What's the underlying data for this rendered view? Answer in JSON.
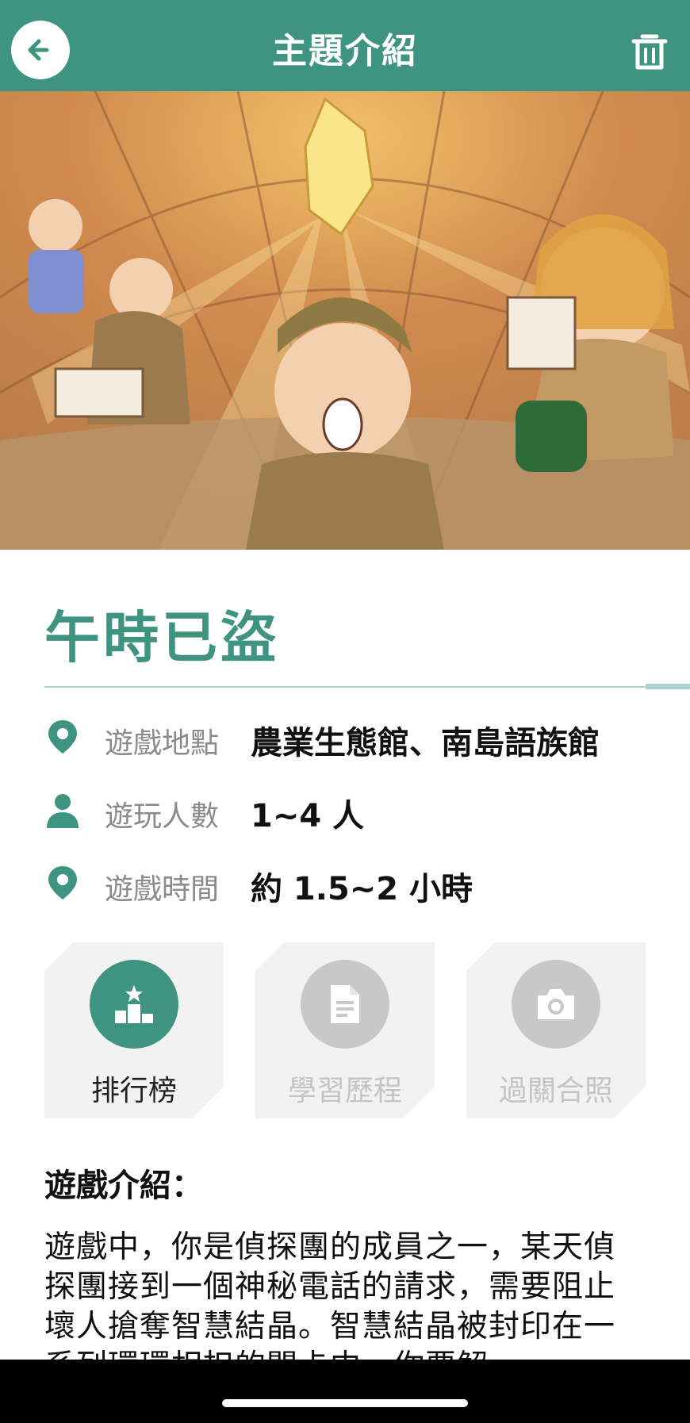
{
  "header": {
    "title": "主題介紹",
    "back_icon": "arrow-left-icon",
    "delete_icon": "trash-icon"
  },
  "colors": {
    "brand": "#3e9480",
    "divider": "#a9d3cf",
    "disabled": "#c8c8c8"
  },
  "theme": {
    "title": "午時已盜"
  },
  "info": [
    {
      "icon": "location-pin-icon",
      "label": "遊戲地點",
      "value": "農業生態館、南島語族館"
    },
    {
      "icon": "person-icon",
      "label": "遊玩人數",
      "value": "1~4 人"
    },
    {
      "icon": "location-pin-icon",
      "label": "遊戲時間",
      "value": "約 1.5~2 小時"
    }
  ],
  "actions": [
    {
      "label": "排行榜",
      "icon": "podium-star-icon",
      "enabled": true
    },
    {
      "label": "學習歷程",
      "icon": "document-icon",
      "enabled": false
    },
    {
      "label": "過關合照",
      "icon": "camera-icon",
      "enabled": false
    }
  ],
  "intro": {
    "heading": "遊戲介紹：",
    "body": "遊戲中，你是偵探團的成員之一，某天偵探團接到一個神秘電話的請求，需要阻止壞人搶奪智慧結晶。智慧結晶被封印在一系列環環相扣的關卡中，你要解"
  }
}
